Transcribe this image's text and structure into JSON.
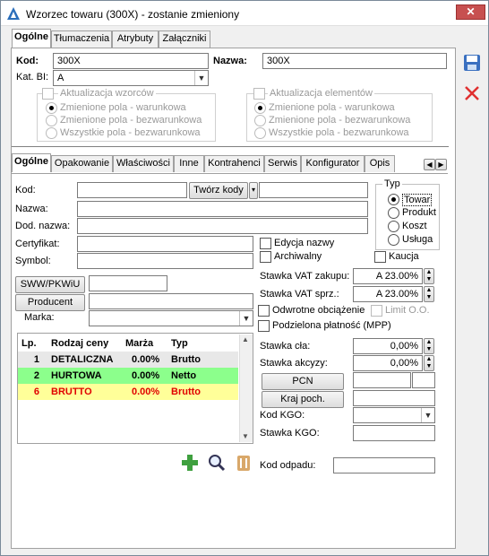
{
  "window": {
    "title": "Wzorzec towaru (300X) - zostanie zmieniony",
    "close": "✕"
  },
  "top_tabs": [
    {
      "label": "Ogólne"
    },
    {
      "label": "Tłumaczenia"
    },
    {
      "label": "Atrybuty"
    },
    {
      "label": "Załączniki"
    }
  ],
  "header": {
    "kod_label": "Kod:",
    "kod_value": "300X",
    "nazwa_label": "Nazwa:",
    "nazwa_value": "300X",
    "katbi_label": "Kat. BI:",
    "katbi_value": "A",
    "akt_wzorcow": {
      "label": "Aktualizacja wzorców",
      "options": [
        "Zmienione pola - warunkowa",
        "Zmienione pola - bezwarunkowa",
        "Wszystkie pola - bezwarunkowa"
      ]
    },
    "akt_elementow": {
      "label": "Aktualizacja elementów",
      "options": [
        "Zmienione pola - warunkowa",
        "Zmienione pola - bezwarunkowa",
        "Wszystkie pola - bezwarunkowa"
      ]
    }
  },
  "sub_tabs": [
    {
      "label": "Ogólne"
    },
    {
      "label": "Opakowanie"
    },
    {
      "label": "Właściwości"
    },
    {
      "label": "Inne"
    },
    {
      "label": "Kontrahenci"
    },
    {
      "label": "Serwis"
    },
    {
      "label": "Konfigurator"
    },
    {
      "label": "Opis"
    }
  ],
  "general": {
    "kod_label": "Kod:",
    "tworz_kody": "Twórz kody",
    "nazwa_label": "Nazwa:",
    "dod_nazwa_label": "Dod. nazwa:",
    "certyfikat_label": "Certyfikat:",
    "symbol_label": "Symbol:",
    "sww_button": "SWW/PKWiU",
    "producent_button": "Producent",
    "marka_label": "Marka:",
    "typ": {
      "label": "Typ",
      "options": [
        "Towar",
        "Produkt",
        "Koszt",
        "Usługa"
      ],
      "selected": "Towar"
    },
    "edycja_nazwy": "Edycja nazwy",
    "archiwalny": "Archiwalny",
    "kaucja": "Kaucja",
    "vat_zakupu_label": "Stawka VAT zakupu:",
    "vat_zakupu_value": "A 23.00%",
    "vat_sprz_label": "Stawka VAT sprz.:",
    "vat_sprz_value": "A 23.00%",
    "odwrotne": "Odwrotne obciążenie",
    "limit": "Limit O.O.",
    "mpp": "Podzielona płatność (MPP)",
    "clo_label": "Stawka cła:",
    "clo_value": "0,00%",
    "akcyza_label": "Stawka akcyzy:",
    "akcyza_value": "0,00%",
    "pcn_button": "PCN",
    "kraj_button": "Kraj poch.",
    "kgo_kod_label": "Kod KGO:",
    "kgo_stawka_label": "Stawka KGO:",
    "kod_odpadu_label": "Kod odpadu:"
  },
  "price_table": {
    "headers": [
      "Lp.",
      "Rodzaj ceny",
      "Marża",
      "Typ"
    ],
    "rows": [
      {
        "lp": "1",
        "name": "DETALICZNA",
        "marza": "0.00%",
        "typ": "Brutto",
        "bg": "#e8e8e8",
        "color": "#000000"
      },
      {
        "lp": "2",
        "name": "HURTOWA",
        "marza": "0.00%",
        "typ": "Netto",
        "bg": "#8cff8c",
        "color": "#000000"
      },
      {
        "lp": "6",
        "name": "BRUTTO",
        "marza": "0.00%",
        "typ": "Brutto",
        "bg": "#ffff99",
        "color": "#e00000"
      }
    ]
  },
  "colors": {
    "accent": "#2a6ebb",
    "close": "#c75050"
  }
}
